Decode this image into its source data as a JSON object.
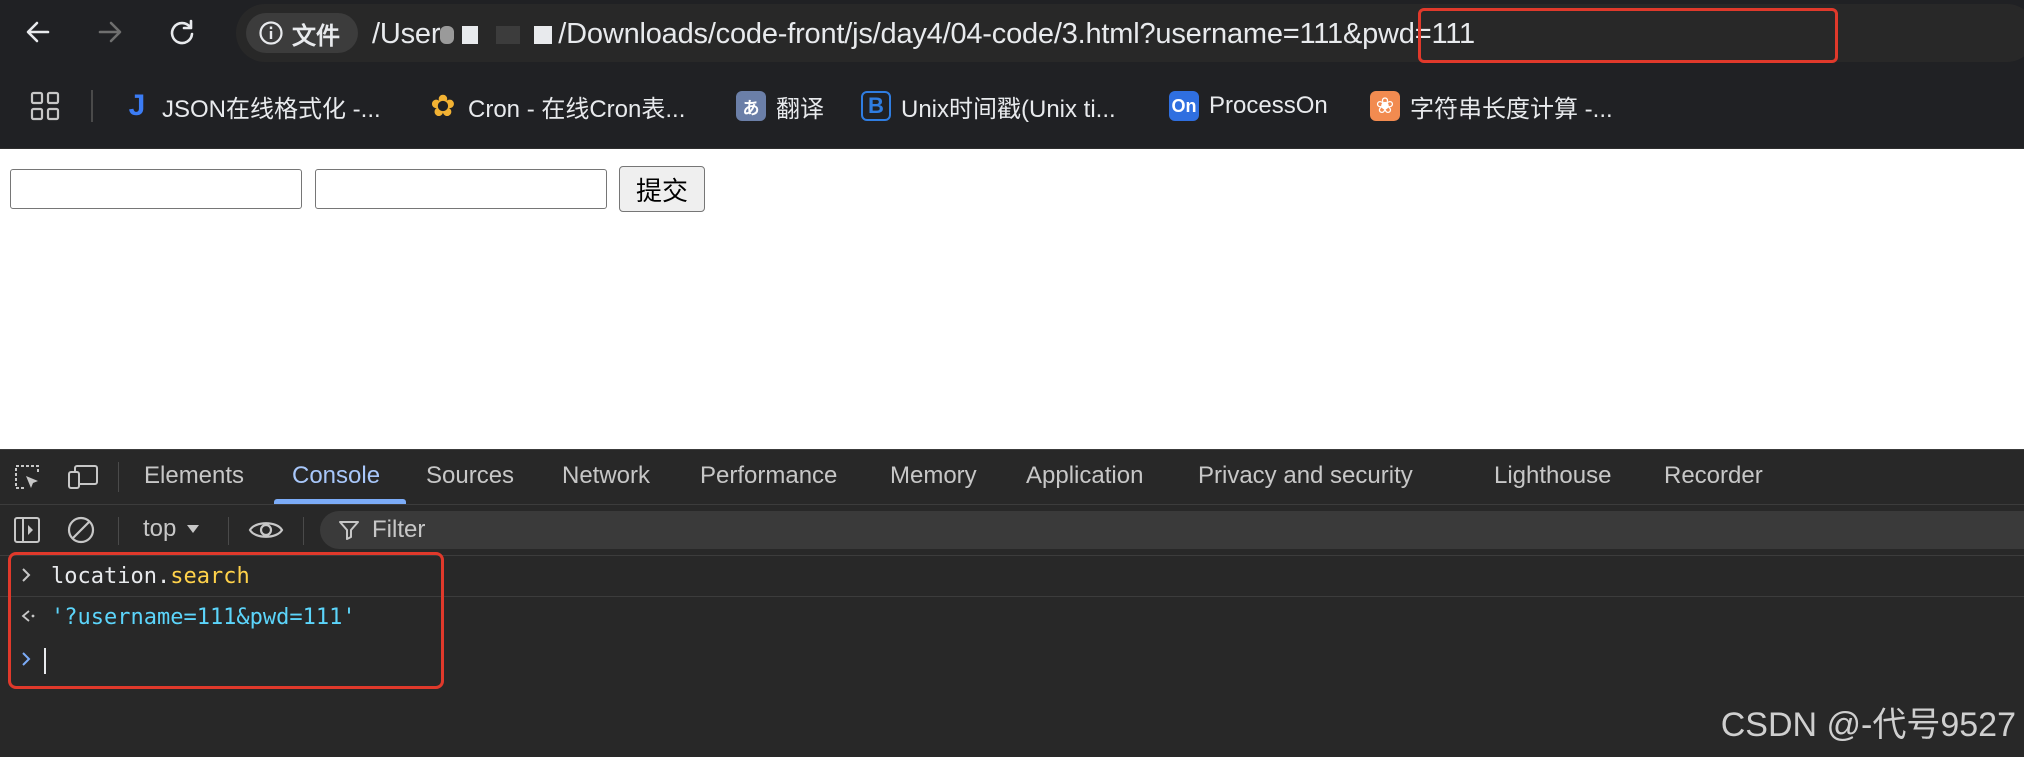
{
  "toolbar": {
    "site_info_label": "文件",
    "url_prefix": "/User",
    "url_path": "/Downloads/code-front/js/day4/04-code/3.html",
    "url_query": "?username=111&pwd=111"
  },
  "bookmarks": [
    {
      "icon": "J",
      "label": "JSON在线格式化 -...",
      "color": "#3b7cf5"
    },
    {
      "icon": "✿",
      "label": "Cron - 在线Cron表...",
      "color": "#f2b233"
    },
    {
      "icon": "あ",
      "label": "翻译",
      "color": "#4a6fb5"
    },
    {
      "icon": "B",
      "label": "Unix时间戳(Unix ti...",
      "color": "#2f7de1"
    },
    {
      "icon": "On",
      "label": "ProcessOn",
      "color": "#2f6fe0"
    },
    {
      "icon": "❀",
      "label": "字符串长度计算 -...",
      "color": "#f28b50"
    }
  ],
  "page": {
    "submit_label": "提交"
  },
  "devtools": {
    "tabs": [
      "Elements",
      "Console",
      "Sources",
      "Network",
      "Performance",
      "Memory",
      "Application",
      "Privacy and security",
      "Lighthouse",
      "Recorder"
    ],
    "active_tab": "Console",
    "context": "top",
    "filter_placeholder": "Filter",
    "console": {
      "input_object": "location",
      "input_dot": ".",
      "input_property": "search",
      "output_value": "'?username=111&pwd=111'"
    }
  },
  "watermark": "CSDN @-代号9527",
  "colors": {
    "highlight": "#e0392b",
    "accent": "#7cacf8",
    "property": "#ffd24a",
    "string": "#5cd5fb"
  }
}
